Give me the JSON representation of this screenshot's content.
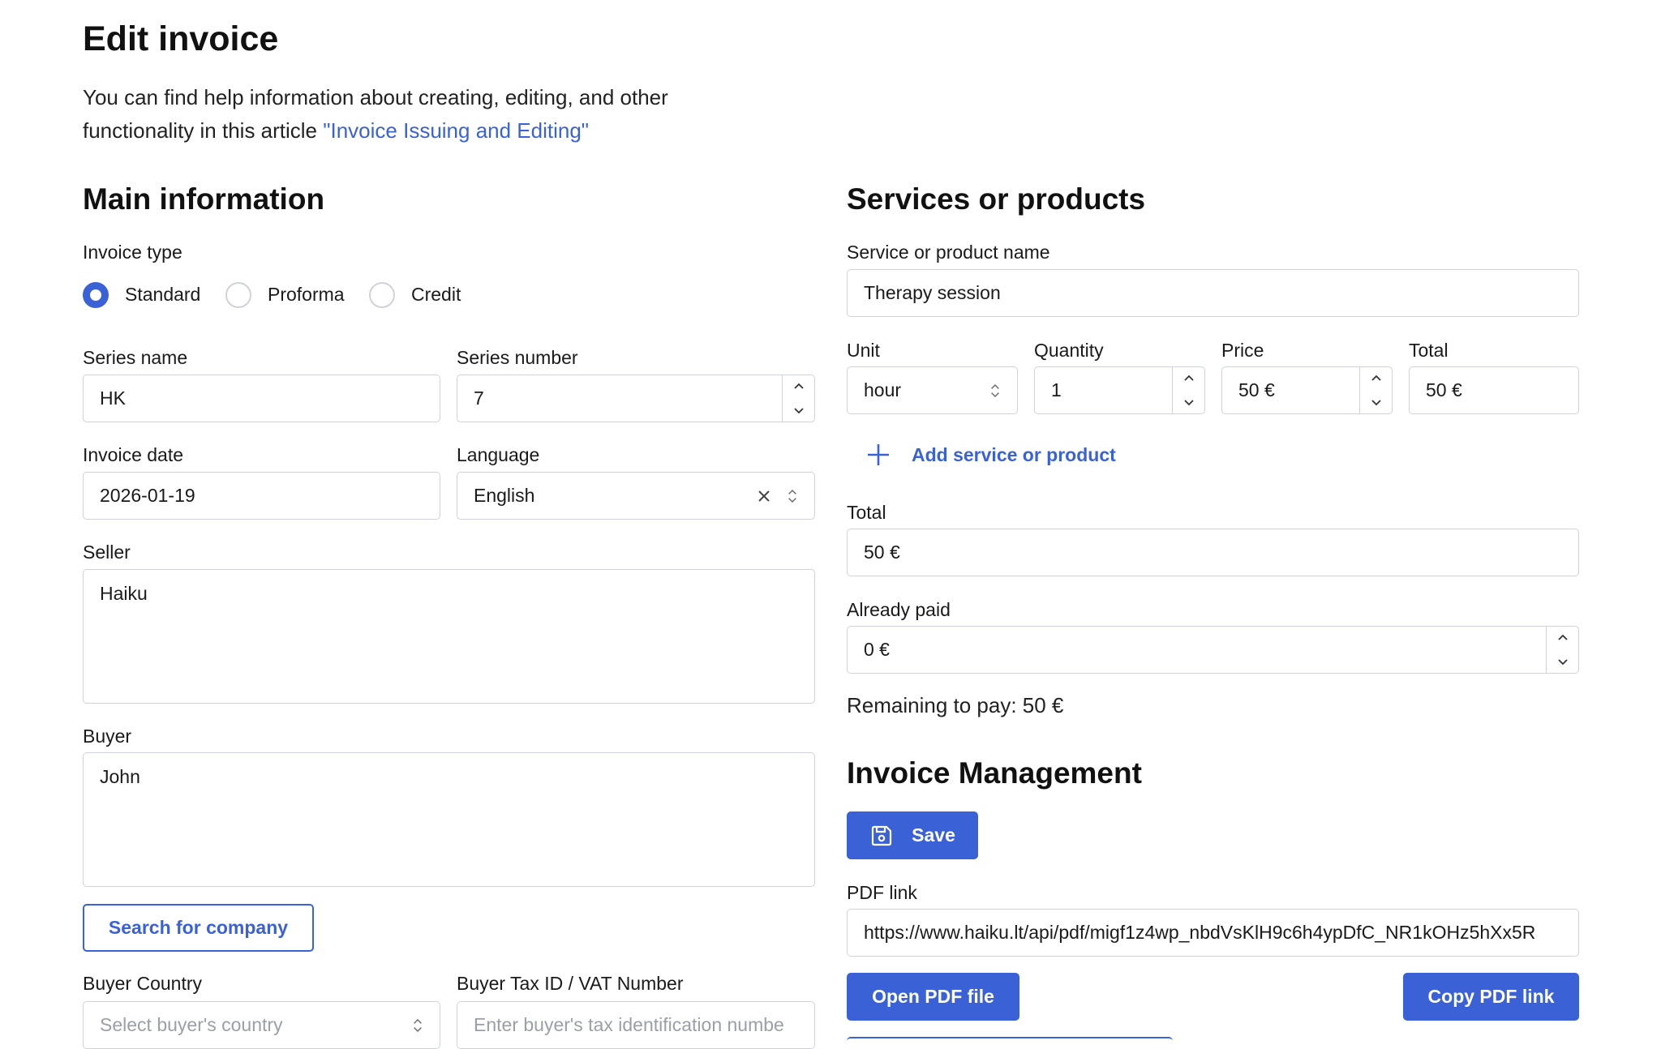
{
  "page": {
    "title": "Edit invoice",
    "help_text": "You can find help information about creating, editing, and other functionality in this article",
    "help_text_line1": "You can find help information about creating, editing, and other",
    "help_text_line2": "functionality in this article",
    "help_link": "\"Invoice Issuing and Editing\""
  },
  "main_info": {
    "heading": "Main information",
    "invoice_type_label": "Invoice type",
    "invoice_types": [
      {
        "label": "Standard",
        "selected": true
      },
      {
        "label": "Proforma",
        "selected": false
      },
      {
        "label": "Credit",
        "selected": false
      }
    ],
    "series_name_label": "Series name",
    "series_name_value": "HK",
    "series_number_label": "Series number",
    "series_number_value": "7",
    "invoice_date_label": "Invoice date",
    "invoice_date_value": "2026-01-19",
    "language_label": "Language",
    "language_value": "English",
    "seller_label": "Seller",
    "seller_value": "Haiku",
    "buyer_label": "Buyer",
    "buyer_value": "John",
    "search_company_button": "Search for company",
    "buyer_country_label": "Buyer Country",
    "buyer_country_placeholder": "Select buyer's country",
    "buyer_tax_label": "Buyer Tax ID / VAT Number",
    "buyer_tax_placeholder": "Enter buyer's tax identification numbe"
  },
  "services": {
    "heading": "Services or products",
    "name_label": "Service or product name",
    "name_value": "Therapy session",
    "unit_label": "Unit",
    "unit_value": "hour",
    "quantity_label": "Quantity",
    "quantity_value": "1",
    "price_label": "Price",
    "price_value": "50 €",
    "line_total_label": "Total",
    "line_total_value": "50 €",
    "add_button": "Add service or product",
    "total_label": "Total",
    "total_value": "50 €",
    "already_paid_label": "Already paid",
    "already_paid_value": "0 €",
    "remaining_text": "Remaining to pay: 50 €"
  },
  "management": {
    "heading": "Invoice Management",
    "save_button": "Save",
    "pdf_link_label": "PDF link",
    "pdf_link_value": "https://www.haiku.lt/api/pdf/migf1z4wp_nbdVsKlH9c6h4ypDfC_NR1kOHz5hXx5R",
    "open_pdf_button": "Open PDF file",
    "copy_pdf_button": "Copy PDF link"
  },
  "colors": {
    "accent": "#3a62d6",
    "border": "#cfd3d9",
    "placeholder": "#9aa0a8"
  }
}
